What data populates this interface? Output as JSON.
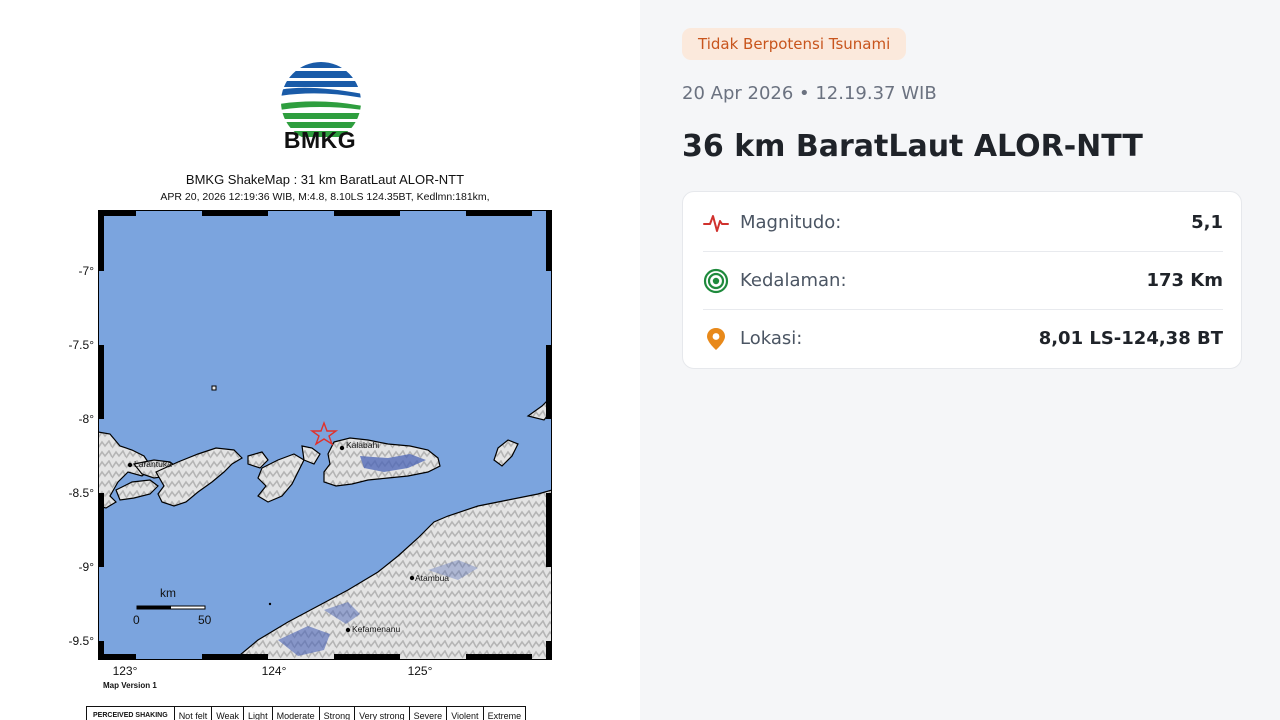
{
  "logo": {
    "text": "BMKG"
  },
  "map": {
    "title": "BMKG ShakeMap : 31 km BaratLaut ALOR-NTT",
    "subtitle": "APR 20, 2026 12:19:36 WIB, M:4.8, 8.10LS 124.35BT, Kedlmn:181km,",
    "lat_labels": [
      "-7°",
      "-7.5°",
      "-8°",
      "-8.5°",
      "-9°",
      "-9.5°"
    ],
    "lon_labels": [
      "123°",
      "124°",
      "125°"
    ],
    "places": [
      "Kalabahi",
      "Larantuka",
      "Atambua",
      "Kefamenanu"
    ],
    "scale": {
      "unit": "km",
      "start": "0",
      "end": "50"
    },
    "version": "Map Version 1",
    "legend": {
      "header": "PERCEIVED SHAKING",
      "levels": [
        "Not felt",
        "Weak",
        "Light",
        "Moderate",
        "Strong",
        "Very strong",
        "Severe",
        "Violent",
        "Extreme"
      ]
    },
    "colors": {
      "sea": "#7ba4de",
      "land": "#e8e8e8",
      "shaded": "#4a63b5",
      "epicenter": "#e0312b"
    }
  },
  "info": {
    "tsunami_badge": "Tidak Berpotensi Tsunami",
    "datetime": "20 Apr 2026 • 12.19.37 WIB",
    "title": "36 km BaratLaut ALOR-NTT",
    "rows": [
      {
        "icon": "pulse-icon",
        "label": "Magnitudo:",
        "value": "5,1",
        "color": "#d0312d"
      },
      {
        "icon": "depth-target-icon",
        "label": "Kedalaman:",
        "value": "173 Km",
        "color": "#1e8a3c"
      },
      {
        "icon": "location-pin-icon",
        "label": "Lokasi:",
        "value": "8,01 LS-124,38 BT",
        "color": "#e8891a"
      }
    ]
  }
}
